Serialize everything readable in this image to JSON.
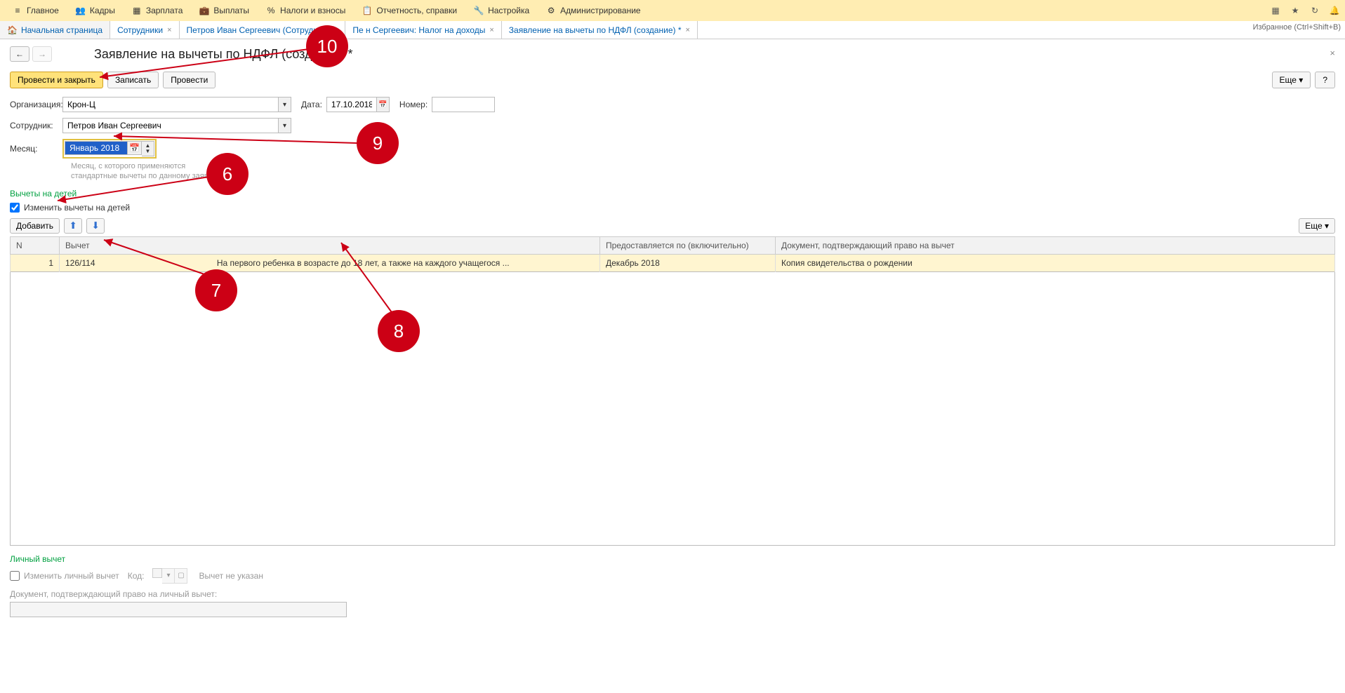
{
  "menu": {
    "items": [
      {
        "label": "Главное",
        "icon": "≡"
      },
      {
        "label": "Кадры",
        "icon": "👥"
      },
      {
        "label": "Зарплата",
        "icon": "▦"
      },
      {
        "label": "Выплаты",
        "icon": "💼"
      },
      {
        "label": "Налоги и взносы",
        "icon": "%"
      },
      {
        "label": "Отчетность, справки",
        "icon": "📋"
      },
      {
        "label": "Настройка",
        "icon": "🔧"
      },
      {
        "label": "Администрирование",
        "icon": "⚙"
      }
    ]
  },
  "tabs": [
    {
      "label": "Начальная страница",
      "home": true
    },
    {
      "label": "Сотрудники",
      "closeable": true
    },
    {
      "label": "Петров Иван Сергеевич (Сотрудник)",
      "closeable": true
    },
    {
      "label": "Пе           н Сергеевич: Налог на доходы",
      "closeable": true
    },
    {
      "label": "Заявление на вычеты по НДФЛ (создание) *",
      "closeable": true,
      "active": true
    }
  ],
  "tabbar_hint": "Избранное (Ctrl+Shift+B)",
  "page": {
    "title": "Заявление на вычеты по НДФЛ (создание) *"
  },
  "toolbar": {
    "post_close": "Провести и закрыть",
    "save": "Записать",
    "post": "Провести",
    "more": "Еще",
    "help": "?"
  },
  "form": {
    "org_label": "Организация:",
    "org_value": "Крон-Ц",
    "date_label": "Дата:",
    "date_value": "17.10.2018",
    "number_label": "Номер:",
    "number_value": "",
    "emp_label": "Сотрудник:",
    "emp_value": "Петров Иван Сергеевич",
    "month_label": "Месяц:",
    "month_value": "Январь 2018",
    "month_hint1": "Месяц, с которого применяются",
    "month_hint2": "стандартные вычеты по данному заявлению"
  },
  "children_section": {
    "title": "Вычеты на детей",
    "checkbox_label": "Изменить вычеты на детей",
    "checked": true,
    "add_btn": "Добавить",
    "more_btn": "Еще ▾"
  },
  "table": {
    "headers": {
      "n": "N",
      "deduction": "Вычет",
      "until": "Предоставляется по (включительно)",
      "document": "Документ, подтверждающий право на вычет"
    },
    "rows": [
      {
        "n": "1",
        "code": "126/114",
        "desc": "На первого ребенка в возрасте до 18 лет, а также на каждого учащегося ...",
        "until": "Декабрь 2018",
        "document": "Копия свидетельства о рождении"
      }
    ]
  },
  "personal_section": {
    "title": "Личный вычет",
    "checkbox_label": "Изменить личный вычет",
    "kod_label": "Код:",
    "not_specified": "Вычет не указан",
    "doc_label": "Документ, подтверждающий право на личный вычет:"
  },
  "callouts": {
    "c6": "6",
    "c7": "7",
    "c8": "8",
    "c9": "9",
    "c10": "10"
  }
}
